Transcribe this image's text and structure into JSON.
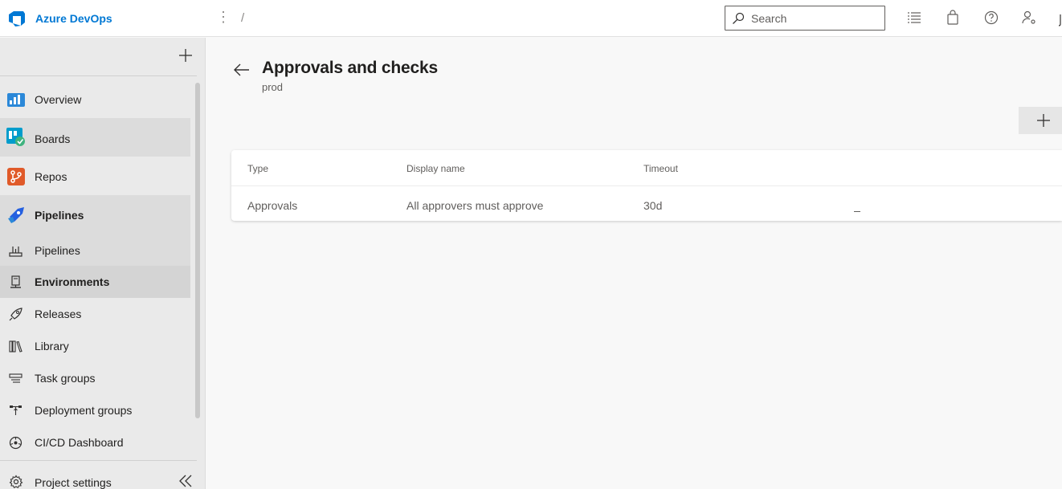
{
  "app": {
    "brand": "Azure DevOps",
    "breadcrumb_separator": "/",
    "more_icon": "vertical-dots-icon"
  },
  "search": {
    "placeholder": "Search"
  },
  "topbar_icons": [
    "list-settings-icon",
    "shopping-bag-icon",
    "help-icon",
    "user-settings-icon"
  ],
  "sidebar": {
    "items": [
      {
        "label": "Overview",
        "icon": "overview-icon"
      },
      {
        "label": "Boards",
        "icon": "boards-icon"
      },
      {
        "label": "Repos",
        "icon": "repos-icon"
      },
      {
        "label": "Pipelines",
        "icon": "pipelines-icon"
      },
      {
        "label": "Pipelines",
        "icon": "pipelines-sub-icon"
      },
      {
        "label": "Environments",
        "icon": "environments-icon"
      },
      {
        "label": "Releases",
        "icon": "rocket-icon"
      },
      {
        "label": "Library",
        "icon": "library-icon"
      },
      {
        "label": "Task groups",
        "icon": "task-groups-icon"
      },
      {
        "label": "Deployment groups",
        "icon": "deployment-groups-icon"
      },
      {
        "label": "CI/CD Dashboard",
        "icon": "dashboard-icon"
      }
    ],
    "settings_label": "Project settings"
  },
  "page": {
    "title": "Approvals and checks",
    "subtitle": "prod"
  },
  "table": {
    "headers": [
      "Type",
      "Display name",
      "Timeout"
    ],
    "rows": [
      {
        "type": "Approvals",
        "display_name": "All approvers must approve",
        "timeout": "30d"
      }
    ]
  },
  "colors": {
    "brand": "#0078d4",
    "boards": "#009ccc",
    "repos": "#e05a29",
    "pipelines": "#2560e0"
  }
}
